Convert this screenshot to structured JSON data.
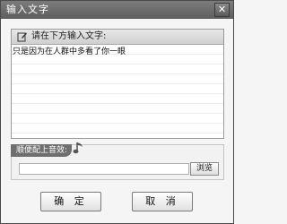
{
  "window": {
    "title": "输入文字",
    "close_label": "✕"
  },
  "input_panel": {
    "header_label": "请在下方输入文字:",
    "text": "只是因为在人群中多看了你一眼"
  },
  "music_panel": {
    "label": "顺便配上音效:",
    "file_value": "",
    "browse_label": "浏览"
  },
  "buttons": {
    "confirm_label": "确 定",
    "cancel_label": "取 消"
  },
  "icons": {
    "edit": "edit-icon",
    "music_note": "music-note-icon",
    "close": "close-icon"
  }
}
